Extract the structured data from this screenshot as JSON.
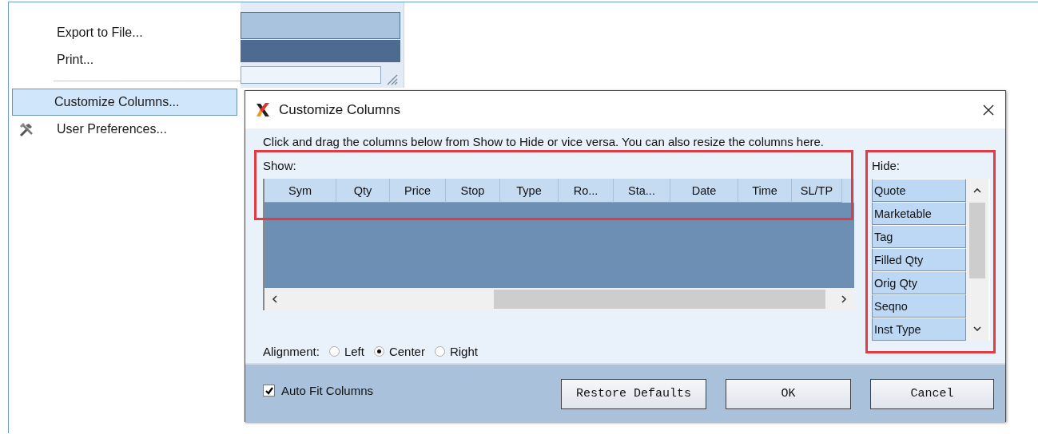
{
  "context_menu": {
    "items": [
      {
        "kind": "item",
        "label": "Export to File...",
        "selected": false,
        "has_icon": false
      },
      {
        "kind": "item",
        "label": "Print...",
        "selected": false,
        "has_icon": false
      },
      {
        "kind": "separator"
      },
      {
        "kind": "item",
        "label": "Customize Columns...",
        "selected": true,
        "has_icon": false
      },
      {
        "kind": "item",
        "label": "User Preferences...",
        "selected": false,
        "has_icon": true
      }
    ]
  },
  "dialog": {
    "title": "Customize Columns",
    "instruction": "Click and drag the columns below from Show to Hide or vice versa. You can also resize the columns here.",
    "show_panel": {
      "label": "Show:",
      "highlighted": true,
      "columns": [
        "Sym",
        "Qty",
        "Price",
        "Stop",
        "Type",
        "Ro...",
        "Sta...",
        "Date",
        "Time",
        "SL/TP"
      ]
    },
    "hide_panel": {
      "label": "Hide:",
      "highlighted": true,
      "items": [
        "Quote",
        "Marketable",
        "Tag",
        "Filled Qty",
        "Orig Qty",
        "Seqno",
        "Inst Type"
      ]
    },
    "alignment": {
      "label": "Alignment:",
      "options": [
        {
          "label": "Left",
          "selected": false
        },
        {
          "label": "Center",
          "selected": true
        },
        {
          "label": "Right",
          "selected": false
        }
      ]
    },
    "auto_fit": {
      "label": "Auto Fit Columns",
      "checked": true
    },
    "buttons": [
      {
        "label": "Restore Defaults"
      },
      {
        "label": "OK"
      },
      {
        "label": "Cancel"
      }
    ]
  }
}
